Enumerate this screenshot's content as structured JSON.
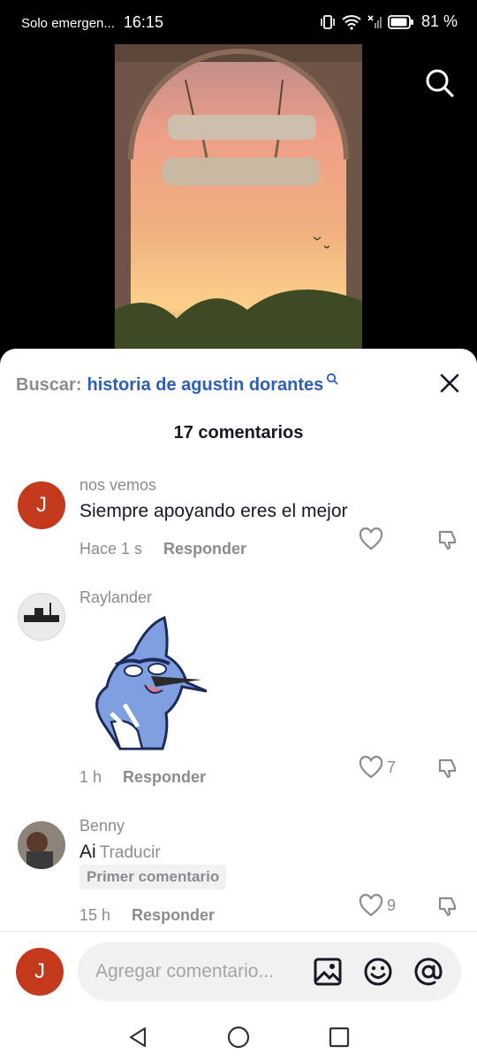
{
  "status_bar": {
    "carrier": "Solo emergen...",
    "time": "16:15",
    "battery": "81 %"
  },
  "search": {
    "prefix": "Buscar:",
    "query": "historia de agustin dorantes"
  },
  "comments_count": "17 comentarios",
  "comments": [
    {
      "user": "nos vemos",
      "text": "Siempre apoyando eres el mejor",
      "time": "Hace 1 s",
      "reply": "Responder",
      "likes": "",
      "avatar_letter": "J"
    },
    {
      "user": "Raylander",
      "text": "",
      "time": "1 h",
      "reply": "Responder",
      "likes": "7",
      "sticker": "blue-jay-cartoon"
    },
    {
      "user": "Benny",
      "text": "Ai",
      "translate": "Traducir",
      "badge": "Primer comentario",
      "time": "15 h",
      "reply": "Responder",
      "likes": "9"
    }
  ],
  "input": {
    "avatar_letter": "J",
    "placeholder": "Agregar comentario..."
  },
  "icons": {
    "search": "search-icon",
    "close": "close-icon",
    "like": "heart-icon",
    "dislike": "thumbs-down-icon",
    "image": "image-icon",
    "emoji": "emoji-icon",
    "mention": "at-icon"
  },
  "colors": {
    "accent_link": "#2b5db9",
    "avatar_red": "#c2391b",
    "muted": "#8a8b91"
  }
}
